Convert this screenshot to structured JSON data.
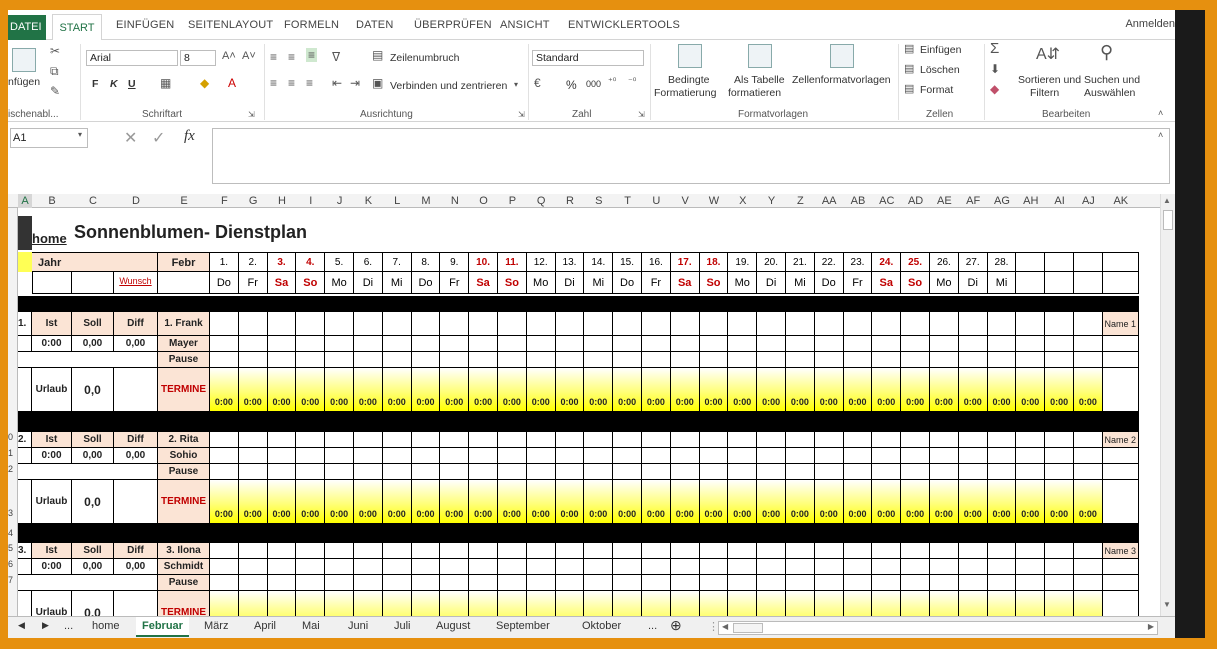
{
  "ribbon_tabs": {
    "file": "DATEI",
    "home": "START",
    "others": [
      "EINFÜGEN",
      "SEITENLAYOUT",
      "FORMELN",
      "DATEN",
      "ÜBERPRÜFEN",
      "ANSICHT",
      "ENTWICKLERTOOLS"
    ],
    "signin": "Anmelden"
  },
  "clipboard": {
    "paste": "nfügen",
    "group": "ischenabl..."
  },
  "font": {
    "name": "Arial",
    "size": "8",
    "bold": "F",
    "italic": "K",
    "underline": "U",
    "group": "Schriftart"
  },
  "alignment": {
    "wrap": "Zeilenumbruch",
    "merge": "Verbinden und zentrieren",
    "group": "Ausrichtung"
  },
  "number": {
    "format": "Standard",
    "percent": "%",
    "thousands": "000",
    "group": "Zahl"
  },
  "styles": {
    "conditional": [
      "Bedingte",
      "Formatierung"
    ],
    "table": [
      "Als Tabelle",
      "formatieren"
    ],
    "cell": "Zellenformatvorlagen",
    "group": "Formatvorlagen"
  },
  "cells": {
    "insert": "Einfügen",
    "delete": "Löschen",
    "format": "Format",
    "group": "Zellen"
  },
  "editing": {
    "sort": [
      "Sortieren und",
      "Filtern"
    ],
    "find": [
      "Suchen und",
      "Auswählen"
    ],
    "group": "Bearbeiten"
  },
  "formula_bar": {
    "name_box": "A1",
    "fx": "fx"
  },
  "columns": [
    "A",
    "B",
    "C",
    "D",
    "E",
    "F",
    "G",
    "H",
    "I",
    "J",
    "K",
    "L",
    "M",
    "N",
    "O",
    "P",
    "Q",
    "R",
    "S",
    "T",
    "U",
    "V",
    "W",
    "X",
    "Y",
    "Z",
    "AA",
    "AB",
    "AC",
    "AD",
    "AE",
    "AF",
    "AG",
    "AH",
    "AI",
    "AJ",
    "AK"
  ],
  "row_numbers": [
    "0",
    "1",
    "2",
    "3",
    "4",
    "5",
    "6",
    "7"
  ],
  "sheet": {
    "home_link": "home",
    "title": "Sonnenblumen- Dienstplan",
    "year_label": "Jahr",
    "month": "Febr",
    "wunsch": "Wunsch",
    "days": [
      "1.",
      "2.",
      "3.",
      "4.",
      "5.",
      "6.",
      "7.",
      "8.",
      "9.",
      "10.",
      "11.",
      "12.",
      "13.",
      "14.",
      "15.",
      "16.",
      "17.",
      "18.",
      "19.",
      "20.",
      "21.",
      "22.",
      "23.",
      "24.",
      "25.",
      "26.",
      "27.",
      "28."
    ],
    "weekdays": [
      "Do",
      "Fr",
      "Sa",
      "So",
      "Mo",
      "Di",
      "Mi",
      "Do",
      "Fr",
      "Sa",
      "So",
      "Mo",
      "Di",
      "Mi",
      "Do",
      "Fr",
      "Sa",
      "So",
      "Mo",
      "Di",
      "Mi",
      "Do",
      "Fr",
      "Sa",
      "So",
      "Mo",
      "Di",
      "Mi"
    ],
    "weekend_color": "#c00000",
    "headers": {
      "ist": "Ist",
      "soll": "Soll",
      "diff": "Diff"
    },
    "pause": "Pause",
    "urlaub": "Urlaub",
    "termine": "TERMINE",
    "zero_time": "0:00",
    "employees": [
      {
        "no": "1.",
        "first": "1. Frank",
        "last": "Mayer",
        "ist": "0:00",
        "soll": "0,00",
        "diff": "0,00",
        "urlaub": "0,0",
        "tag": "Name 1"
      },
      {
        "no": "2.",
        "first": "2. Rita",
        "last": "Sohio",
        "ist": "0:00",
        "soll": "0,00",
        "diff": "0,00",
        "urlaub": "0,0",
        "tag": "Name 2"
      },
      {
        "no": "3.",
        "first": "3. Ilona",
        "last": "Schmidt",
        "ist": "0:00",
        "soll": "0,00",
        "diff": "0,00",
        "urlaub": "0,0",
        "tag": "Name 3"
      }
    ]
  },
  "sheet_tabs": [
    "home",
    "Februar",
    "März",
    "April",
    "Mai",
    "Juni",
    "Juli",
    "August",
    "September",
    "Oktober"
  ],
  "active_sheet": "Februar",
  "tab_nav": {
    "more_left": "...",
    "more_right": "...",
    "add": "⊕"
  }
}
